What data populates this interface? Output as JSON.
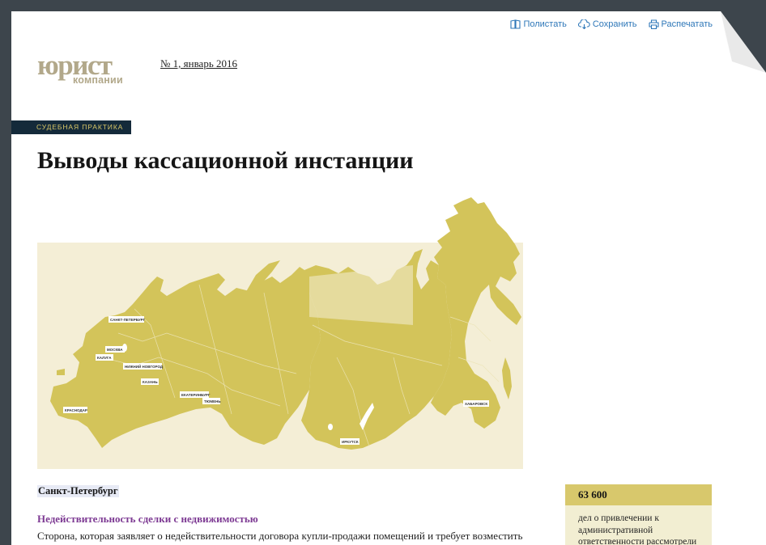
{
  "toolbar": {
    "browse_label": "Полистать",
    "save_label": "Сохранить",
    "print_label": "Распечатать"
  },
  "logo": {
    "main": "юрист",
    "sub": "компании"
  },
  "issue": "№ 1, январь 2016",
  "rubric": "СУДЕБНАЯ ПРАКТИКА",
  "title": "Выводы кассационной инстанции",
  "map": {
    "cities": [
      "САНКТ-ПЕТЕРБУРГ",
      "МОСКВА",
      "КАЛУГА",
      "НИЖНИЙ НОВГОРОД",
      "КАЗАНЬ",
      "ЕКАТЕРИНБУРГ",
      "ТЮМЕНЬ",
      "КРАСНОДАР",
      "ИРКУТСК",
      "ХАБАРОВСК"
    ]
  },
  "article": {
    "city": "Санкт-Петербург",
    "subheading": "Недействительность сделки с недвижимостью",
    "lead": "Сторона, которая заявляет о недействительности договора купли-продажи помещений и требует возместить"
  },
  "stat": {
    "number": "63 600",
    "text": [
      "дел о привлечении к",
      "административной",
      "ответственности рассмотрели"
    ]
  },
  "colors": {
    "background": "#3d454c",
    "link": "#2e77b8",
    "rubric_bg": "#142a3a",
    "rubric_text": "#d8c667",
    "map_land": "#d3c45a",
    "map_bg": "#f4eed6",
    "subheading": "#7d3a93",
    "stat_head": "#d8c86c",
    "stat_body": "#f2eed2"
  }
}
